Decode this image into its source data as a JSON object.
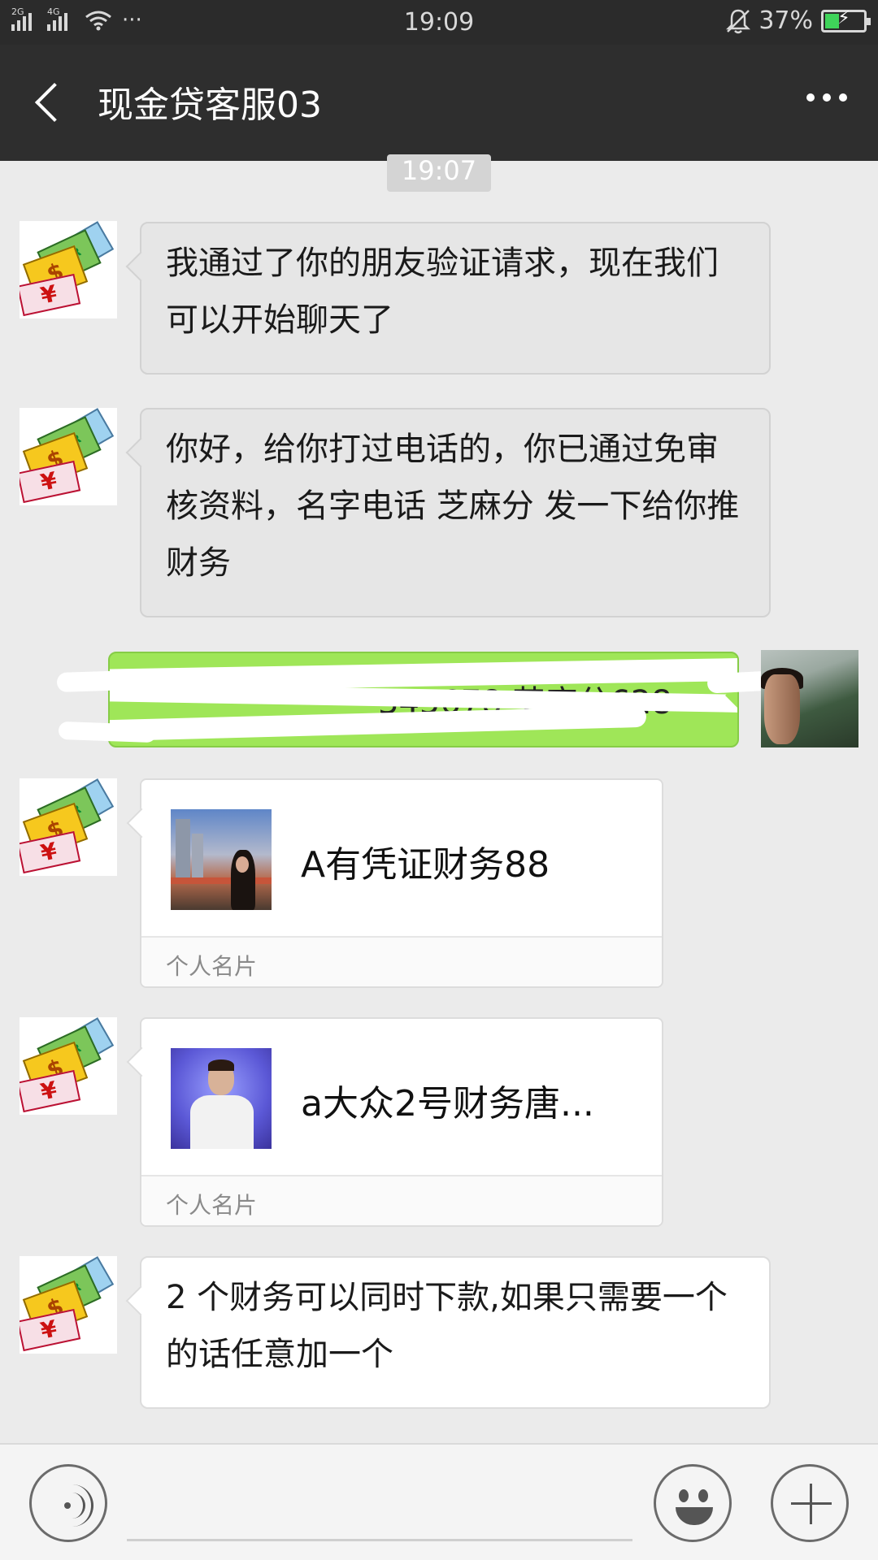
{
  "status_bar": {
    "signal_1": "2G",
    "signal_2": "4G",
    "more": "···",
    "time": "19:09",
    "battery_text": "37%",
    "battery_level": 0.37
  },
  "header": {
    "title": "现金贷客服03",
    "back_icon": "chevron-left-icon",
    "more_icon": "more-dots-icon"
  },
  "timestamp": "19:07",
  "messages": [
    {
      "sender": "other",
      "text": "我通过了你的朋友验证请求，现在我们可以开始聊天了"
    },
    {
      "sender": "other",
      "text": "你好，给你打过电话的，你已通过免审核资料，名字电话 芝麻分 发一下给你推财务"
    },
    {
      "sender": "self",
      "text": "345678  芝麻分628"
    },
    {
      "sender": "other",
      "type": "card",
      "name": "A有凭证财务88",
      "footer": "个人名片"
    },
    {
      "sender": "other",
      "type": "card",
      "name": "a大众2号财务唐...",
      "footer": "个人名片"
    },
    {
      "sender": "other",
      "text": "2 个财务可以同时下款,如果只需要一个的话任意加一个"
    }
  ],
  "money_icon": {
    "euro": "EUR",
    "dollar": "$",
    "yuan": "¥"
  },
  "bottom_bar": {
    "voice_icon": "voice-icon",
    "emoji_icon": "emoji-icon",
    "plus_icon": "plus-icon"
  },
  "colors": {
    "self_bubble": "#9fe658",
    "other_bubble": "#e6e6e6",
    "header_bg": "#2e2e2e"
  }
}
